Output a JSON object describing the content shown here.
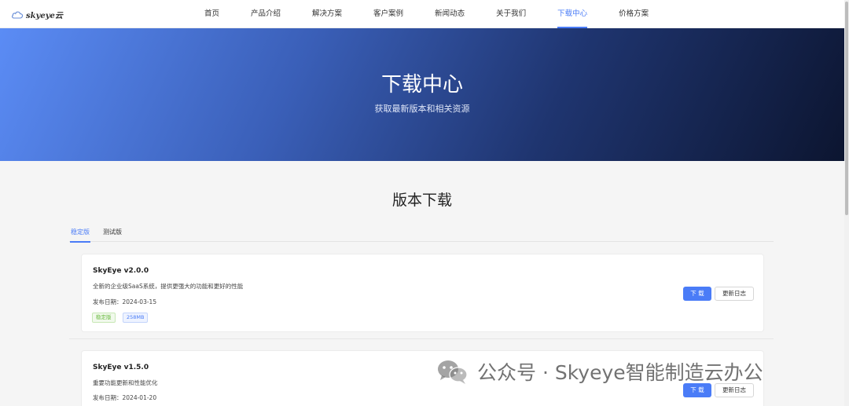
{
  "nav": {
    "logo_text": "skyeye云",
    "items": [
      "首页",
      "产品介绍",
      "解决方案",
      "客户案例",
      "新闻动态",
      "关于我们",
      "下载中心",
      "价格方案"
    ],
    "active_index": 6
  },
  "hero": {
    "title": "下载中心",
    "subtitle": "获取最新版本和相关资源"
  },
  "section": {
    "title": "版本下载",
    "tabs": [
      "稳定版",
      "测试版"
    ],
    "active_tab": 0
  },
  "cards": [
    {
      "name": "SkyEye v2.0.0",
      "description": "全新的企业级SaaS系统，提供更强大的功能和更好的性能",
      "date": "发布日期：2024-03-15",
      "tags": [
        "稳定版",
        "258MB"
      ],
      "download_label": "下 载",
      "changelog_label": "更新日志"
    },
    {
      "name": "SkyEye v1.5.0",
      "description": "重要功能更新和性能优化",
      "date": "发布日期：2024-01-20",
      "download_label": "下 载",
      "changelog_label": "更新日志"
    }
  ],
  "watermark": {
    "text": "公众号 · Skyeye智能制造云办公"
  },
  "colors": {
    "accent": "#4a7cf7",
    "tag_green": "#67b93e"
  }
}
